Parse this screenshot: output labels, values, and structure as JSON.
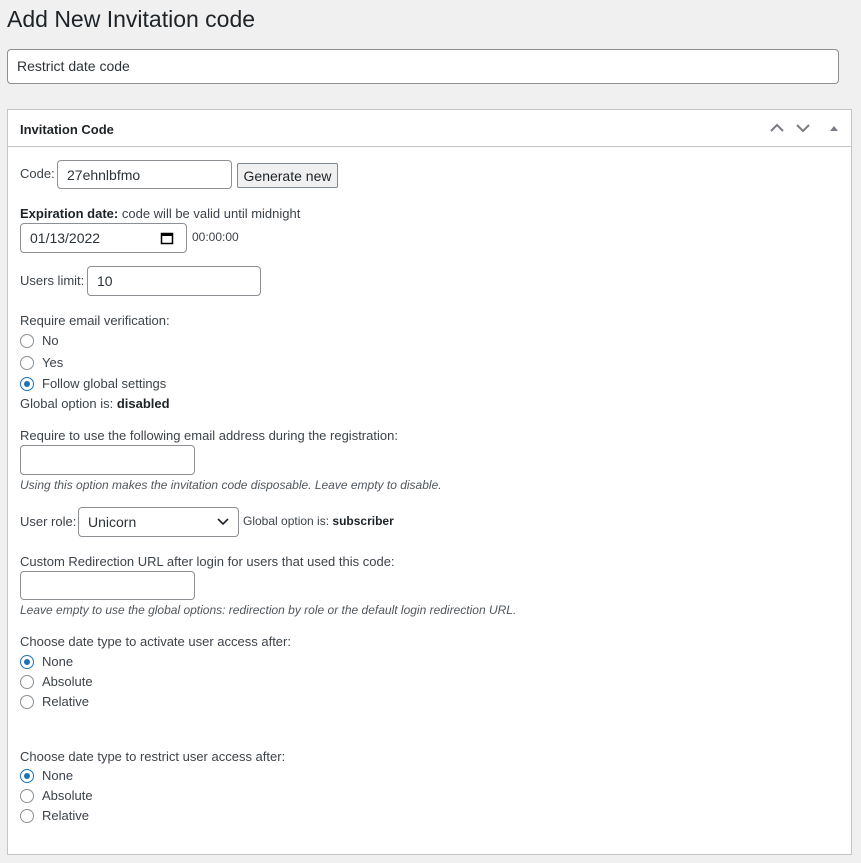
{
  "page_title": "Add New Invitation code",
  "post_title": "Restrict date code",
  "box": {
    "title": "Invitation Code",
    "controls": [
      "chevron-up-icon",
      "chevron-down-icon",
      "triangle-up-icon"
    ]
  },
  "code": {
    "label": "Code:",
    "value": "27ehnlbfmo",
    "generate_label": "Generate new"
  },
  "expiration": {
    "label_bold": "Expiration date:",
    "label_rest": " code will be valid until midnight",
    "date_value": "01/13/2022",
    "time": "00:00:00"
  },
  "users_limit": {
    "label": "Users limit:",
    "value": "10"
  },
  "email_verification": {
    "label": "Require email verification:",
    "options": [
      "No",
      "Yes",
      "Follow global settings"
    ],
    "selected": "Follow global settings",
    "global_prefix": "Global option is: ",
    "global_value": "disabled"
  },
  "required_email": {
    "label": "Require to use the following email address during the registration:",
    "value": "",
    "hint": "Using this option makes the invitation code disposable. Leave empty to disable."
  },
  "user_role": {
    "label": "User role:",
    "value": "Unicorn",
    "global_prefix": "Global option is: ",
    "global_value": "subscriber"
  },
  "redirect": {
    "label": "Custom Redirection URL after login for users that used this code:",
    "value": "",
    "hint": "Leave empty to use the global options: redirection by role or the default login redirection URL."
  },
  "activate": {
    "label": "Choose date type to activate user access after:",
    "options": [
      "None",
      "Absolute",
      "Relative"
    ],
    "selected": "None"
  },
  "restrict": {
    "label": "Choose date type to restrict user access after:",
    "options": [
      "None",
      "Absolute",
      "Relative"
    ],
    "selected": "None"
  },
  "accent_color": "#2271b1"
}
